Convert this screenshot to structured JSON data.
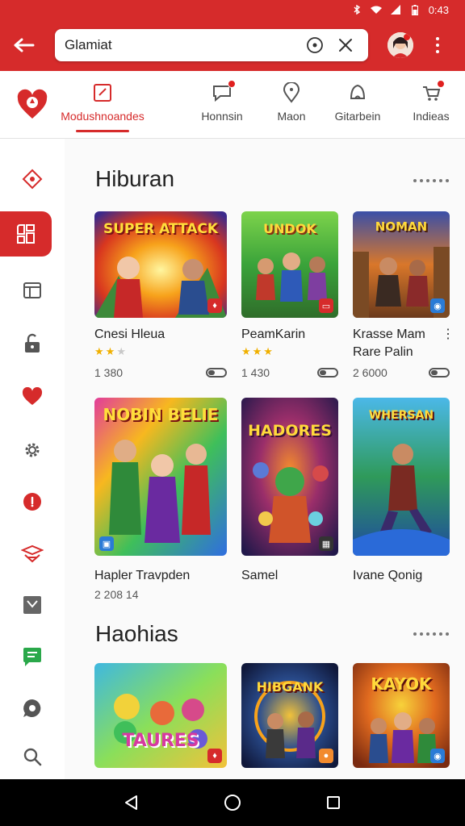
{
  "status_bar": {
    "time": "0:43",
    "icons": [
      "bluetooth-icon",
      "wifi-icon",
      "signal-icon",
      "battery-icon"
    ]
  },
  "top_bar": {
    "search_value": "Glamiat",
    "back_icon": "back-arrow-icon",
    "mic_icon": "mic-icon",
    "clear_icon": "close-icon",
    "menu_icon": "more-vert-icon",
    "brand_color": "#d62b2b"
  },
  "tabs": [
    {
      "label": "Modushnoandes",
      "icon": "edit-icon",
      "active": true,
      "badge": false
    },
    {
      "label": "Honnsin",
      "icon": "chat-icon",
      "active": false,
      "badge": true
    },
    {
      "label": "Maon",
      "icon": "location-icon",
      "active": false,
      "badge": false
    },
    {
      "label": "Gitarbein",
      "icon": "bell-icon",
      "active": false,
      "badge": false
    },
    {
      "label": "Indieas",
      "icon": "cart-icon",
      "active": false,
      "badge": true
    }
  ],
  "side_rail": [
    {
      "icon": "badge-icon",
      "active": false
    },
    {
      "icon": "apps-icon",
      "active": true
    },
    {
      "icon": "window-icon",
      "active": false
    },
    {
      "icon": "unlock-icon",
      "active": false
    },
    {
      "icon": "heart-icon",
      "active": false
    },
    {
      "icon": "gear-icon",
      "active": false
    },
    {
      "icon": "pin-icon",
      "active": false
    },
    {
      "icon": "router-icon",
      "active": false
    },
    {
      "icon": "checkbox-icon",
      "active": false
    },
    {
      "icon": "message-icon",
      "active": false
    },
    {
      "icon": "chat-bubble-icon",
      "active": false
    },
    {
      "icon": "search-icon",
      "active": false
    }
  ],
  "sections": [
    {
      "title": "Hiburan",
      "cards": [
        {
          "thumb_text": "SUPER ATTACK",
          "title": "Cnesi Hleua",
          "subtitle": "",
          "rating": 2,
          "count": "1 380",
          "toggle": true,
          "menu": false
        },
        {
          "thumb_text": "UNDOK",
          "title": "PeamKarin",
          "subtitle": "",
          "rating": 3,
          "count": "1 430",
          "toggle": true,
          "menu": false
        },
        {
          "thumb_text": "NOMAN",
          "title": "Krasse Mam",
          "subtitle": "Rare Palin",
          "rating": 0,
          "count": "2 6000",
          "toggle": true,
          "menu": true
        },
        {
          "thumb_text": "NOBIN BELIE",
          "title": "Hapler Travpden",
          "subtitle": "",
          "rating": 0,
          "count": "2 208 14",
          "toggle": false,
          "menu": false
        },
        {
          "thumb_text": "HADORES",
          "title": "Samel",
          "subtitle": "",
          "rating": 0,
          "count": "",
          "toggle": false,
          "menu": false
        },
        {
          "thumb_text": "WHERSAN",
          "title": "Ivane Qonig",
          "subtitle": "",
          "rating": 0,
          "count": "",
          "toggle": false,
          "menu": false
        }
      ]
    },
    {
      "title": "Haohias",
      "cards": [
        {
          "thumb_text": "TAURES",
          "title": "",
          "subtitle": "",
          "rating": 0,
          "count": "",
          "toggle": false,
          "menu": false
        },
        {
          "thumb_text": "HIBGANK",
          "title": "",
          "subtitle": "",
          "rating": 0,
          "count": "",
          "toggle": false,
          "menu": false
        },
        {
          "thumb_text": "KAYOK",
          "title": "",
          "subtitle": "",
          "rating": 0,
          "count": "",
          "toggle": false,
          "menu": false
        }
      ]
    }
  ],
  "nav_bar": {
    "buttons": [
      "back-triangle-icon",
      "home-circle-icon",
      "recents-square-icon"
    ]
  }
}
